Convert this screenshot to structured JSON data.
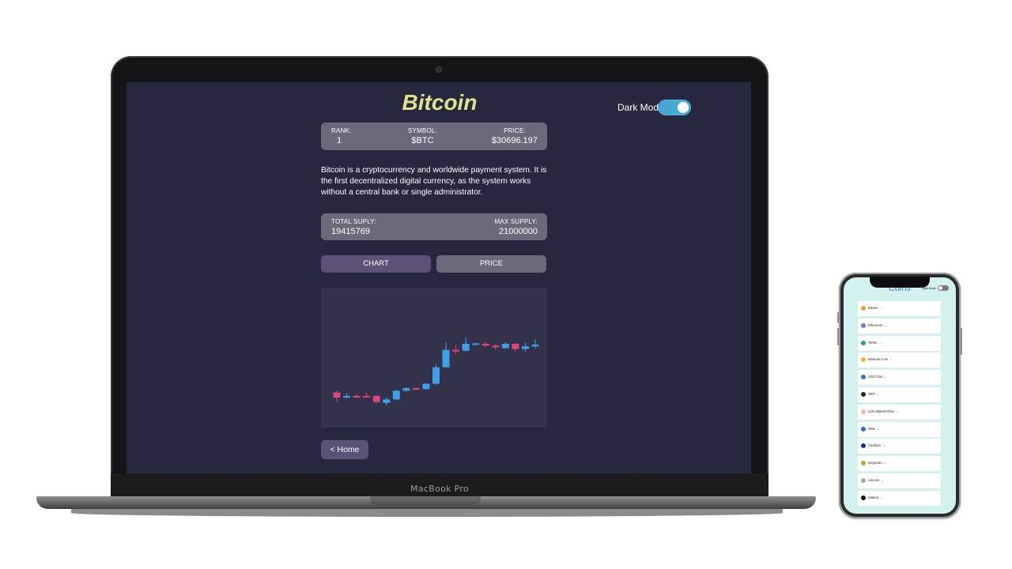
{
  "device_label": "MacBook Pro",
  "coin_page": {
    "title": "Bitcoin",
    "dark_mode_label": "Dark Mode",
    "stats": {
      "rank_label": "RANK:",
      "rank_value": "1",
      "symbol_label": "SYMBOL:",
      "symbol_value": "$BTC",
      "price_label": "PRICE:",
      "price_value": "$30696.197"
    },
    "description": "Bitcoin is a cryptocurrency and worldwide payment system. It is the first decentralized digital currency, as the system works without a central bank or single administrator.",
    "supply": {
      "total_label": "TOTAL SUPLY:",
      "total_value": "19415769",
      "max_label": "MAX SUPPLY:",
      "max_value": "21000000"
    },
    "tabs": {
      "chart_label": "CHART",
      "price_label": "PRICE"
    },
    "home_button": "< Home",
    "colors": {
      "up": "#3fa0ea",
      "down": "#e0457b",
      "accent": "#dfe48a"
    }
  },
  "chart_data": {
    "type": "candlestick",
    "series": [
      {
        "o": 6,
        "c": 12,
        "h": 4,
        "l": 17
      },
      {
        "o": 11,
        "c": 10,
        "h": 7,
        "l": 13
      },
      {
        "o": 10,
        "c": 10.5,
        "h": 8,
        "l": 12
      },
      {
        "o": 10,
        "c": 10.5,
        "h": 6,
        "l": 12
      },
      {
        "o": 10,
        "c": 17,
        "h": 9,
        "l": 19
      },
      {
        "o": 18,
        "c": 14,
        "h": 12,
        "l": 21
      },
      {
        "o": 14,
        "c": 4,
        "h": 3,
        "l": 15
      },
      {
        "o": 4,
        "c": 1,
        "h": 0,
        "l": 5
      },
      {
        "o": 1,
        "c": 1.5,
        "h": 0,
        "l": 3
      },
      {
        "o": 2,
        "c": -4,
        "h": -5,
        "l": 3
      },
      {
        "o": -4,
        "c": -23,
        "h": -26,
        "l": -3
      },
      {
        "o": -23,
        "c": -43,
        "h": -52,
        "l": -22
      },
      {
        "o": -43,
        "c": -42,
        "h": -49,
        "l": -38
      },
      {
        "o": -42,
        "c": -50,
        "h": -57,
        "l": -41
      },
      {
        "o": -50,
        "c": -50.5,
        "h": -51,
        "l": -49
      },
      {
        "o": -50,
        "c": -48,
        "h": -52,
        "l": -46
      },
      {
        "o": -48,
        "c": -46,
        "h": -49,
        "l": -43
      },
      {
        "o": -45,
        "c": -50,
        "h": -52,
        "l": -44
      },
      {
        "o": -50,
        "c": -44,
        "h": -51,
        "l": -41
      },
      {
        "o": -44,
        "c": -47,
        "h": -51,
        "l": -41
      },
      {
        "o": -47,
        "c": -49,
        "h": -55,
        "l": -45
      }
    ]
  },
  "phone": {
    "title": "Coins",
    "mode_label": "Light Mode",
    "coins": [
      {
        "name": "Bitcoin →",
        "color": "#f2a12d"
      },
      {
        "name": "Ethereum →",
        "color": "#627eea"
      },
      {
        "name": "Tether →",
        "color": "#26a17b"
      },
      {
        "name": "Binance Coin →",
        "color": "#f3ba2f"
      },
      {
        "name": "USD Coin →",
        "color": "#2775ca"
      },
      {
        "name": "XRP →",
        "color": "#23292f"
      },
      {
        "name": "Lido Staked Ether →",
        "color": "#f7b7a3"
      },
      {
        "name": "OKB →",
        "color": "#2e6ae6"
      },
      {
        "name": "Cardano →",
        "color": "#0033ad"
      },
      {
        "name": "Dogecoin →",
        "color": "#c2a633"
      },
      {
        "name": "Litecoin →",
        "color": "#a6a9aa"
      },
      {
        "name": "Solana →",
        "color": "#14161f"
      }
    ]
  }
}
